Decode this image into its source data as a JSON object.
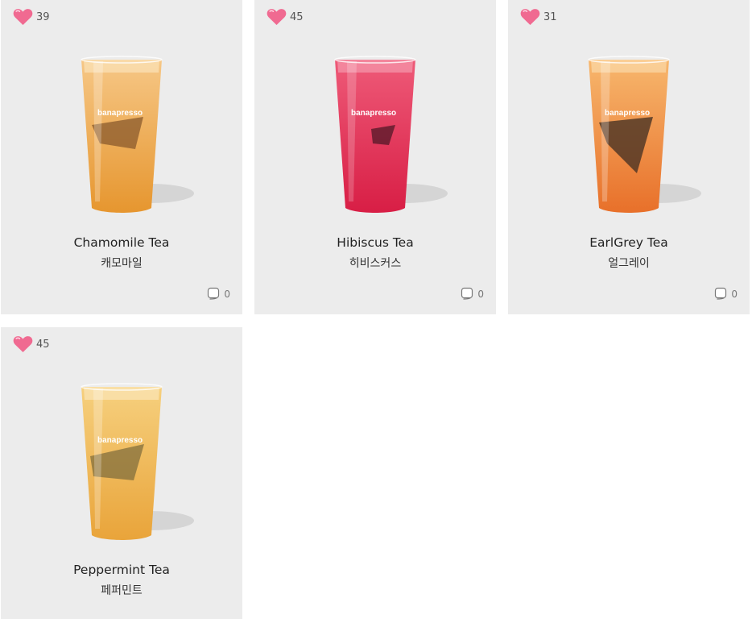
{
  "products": [
    {
      "likes": "39",
      "name_en": "Chamomile Tea",
      "name_ko": "캐모마일",
      "comments": "0",
      "colors": {
        "top": "#f6c786",
        "bottom": "#e6962f",
        "bag": "#8a5a2c"
      }
    },
    {
      "likes": "45",
      "name_en": "Hibiscus Tea",
      "name_ko": "히비스커스",
      "comments": "0",
      "colors": {
        "top": "#ee5a78",
        "bottom": "#d81e45",
        "bag": "#5a1a2a"
      }
    },
    {
      "likes": "31",
      "name_en": "EarlGrey Tea",
      "name_ko": "얼그레이",
      "comments": "0",
      "colors": {
        "top": "#f7b76d",
        "bottom": "#e8702a",
        "bag": "#4a3324"
      }
    },
    {
      "likes": "45",
      "name_en": "Peppermint Tea",
      "name_ko": "페퍼민트",
      "comments": null,
      "colors": {
        "top": "#f6d07e",
        "bottom": "#e9a43a",
        "bag": "#7b6a3a"
      }
    }
  ],
  "brand_text": "banapresso",
  "icons": {
    "like": "heart-icon",
    "comment": "comment-icon"
  },
  "accent": {
    "heart": "#f06a91"
  }
}
